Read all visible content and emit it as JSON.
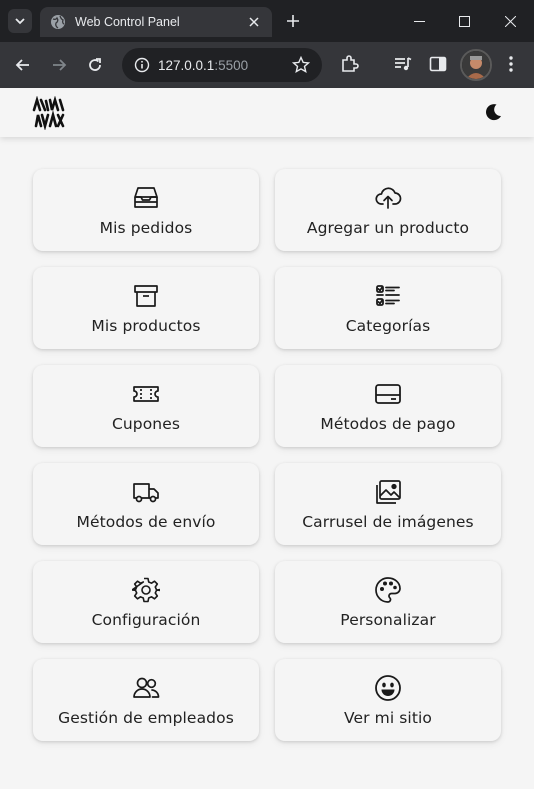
{
  "browser": {
    "tab_title": "Web Control Panel",
    "url_host": "127.0.0.1",
    "url_port": ":5500"
  },
  "header": {
    "logo_icon": "brand-logo",
    "theme_icon": "moon-icon"
  },
  "menu": [
    {
      "label": "Mis pedidos",
      "icon": "inbox-icon"
    },
    {
      "label": "Agregar un producto",
      "icon": "cloud-upload-icon"
    },
    {
      "label": "Mis productos",
      "icon": "archive-icon"
    },
    {
      "label": "Categorías",
      "icon": "checklist-icon"
    },
    {
      "label": "Cupones",
      "icon": "ticket-icon"
    },
    {
      "label": "Métodos de pago",
      "icon": "credit-card-icon"
    },
    {
      "label": "Métodos de envío",
      "icon": "truck-icon"
    },
    {
      "label": "Carrusel de imágenes",
      "icon": "images-icon"
    },
    {
      "label": "Configuración",
      "icon": "gear-icon"
    },
    {
      "label": "Personalizar",
      "icon": "palette-icon"
    },
    {
      "label": "Gestión de empleados",
      "icon": "users-icon"
    },
    {
      "label": "Ver mi sitio",
      "icon": "smiley-icon"
    }
  ]
}
